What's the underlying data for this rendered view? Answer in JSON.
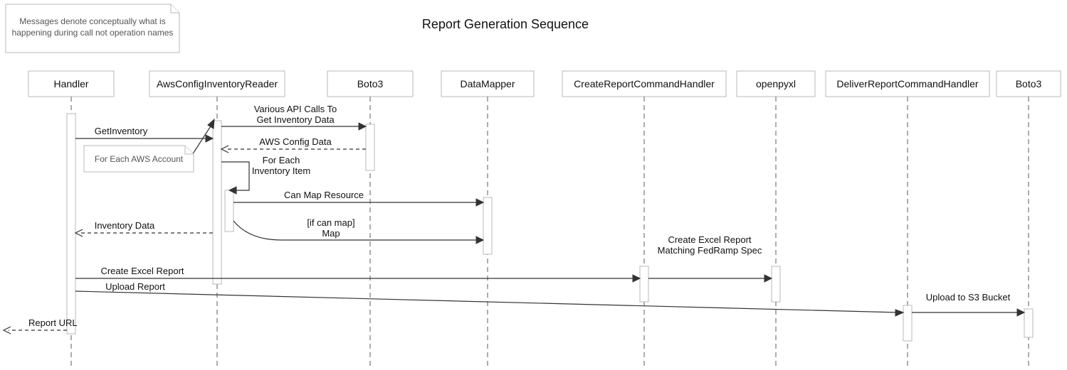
{
  "title": "Report Generation Sequence",
  "participants": [
    {
      "id": "handler",
      "label": "Handler"
    },
    {
      "id": "reader",
      "label": "AwsConfigInventoryReader"
    },
    {
      "id": "boto3a",
      "label": "Boto3"
    },
    {
      "id": "mapper",
      "label": "DataMapper"
    },
    {
      "id": "createh",
      "label": "CreateReportCommandHandler"
    },
    {
      "id": "openpyxl",
      "label": "openpyxl"
    },
    {
      "id": "deliverh",
      "label": "DeliverReportCommandHandler"
    },
    {
      "id": "boto3b",
      "label": "Boto3"
    }
  ],
  "notes": {
    "top": {
      "line1": "Messages denote conceptually what is",
      "line2": "happening during call not operation names"
    },
    "account": {
      "line1": "For Each AWS Account"
    }
  },
  "messages": {
    "get_inventory": "GetInventory",
    "api_calls_l1": "Various API Calls To",
    "api_calls_l2": "Get Inventory Data",
    "config_data": "AWS Config Data",
    "foreach_item_l1": "For Each",
    "foreach_item_l2": "Inventory Item",
    "can_map": "Can Map Resource",
    "map_cond": "[if can map]",
    "map": "Map",
    "inventory_data": "Inventory Data",
    "create_report": "Create Excel Report",
    "create_excel_l1": "Create Excel Report",
    "create_excel_l2": "Matching FedRamp Spec",
    "upload_report": "Upload Report",
    "upload_s3": "Upload to S3 Bucket",
    "report_url": "Report URL"
  }
}
